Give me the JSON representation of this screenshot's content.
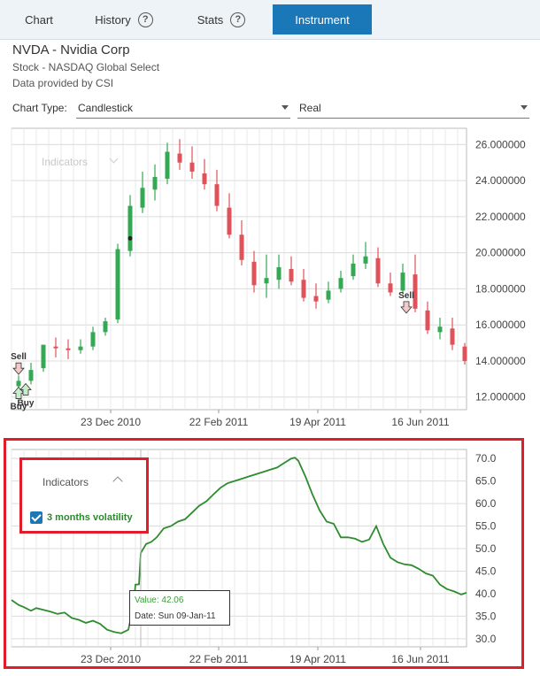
{
  "tabs": [
    {
      "label": "Chart",
      "help": false,
      "active": false
    },
    {
      "label": "History",
      "help": true,
      "active": false
    },
    {
      "label": "Stats",
      "help": true,
      "active": false
    },
    {
      "label": "Instrument",
      "help": false,
      "active": true
    }
  ],
  "instrument": {
    "title": "NVDA - Nvidia Corp",
    "exchange": "Stock - NASDAQ Global Select",
    "provider": "Data provided by CSI"
  },
  "controls": {
    "chart_type_label": "Chart Type:",
    "chart_type_value": "Candlestick",
    "price_mode_value": "Real"
  },
  "price_panel": {
    "indicators_label": "Indicators",
    "markers": [
      {
        "label": "Sell",
        "kind": "sell",
        "date": "2010-11-01",
        "price": 13.4
      },
      {
        "label": "Buy",
        "kind": "buy",
        "date": "2010-11-01",
        "price": 12.5
      },
      {
        "label": "Buy",
        "kind": "buy",
        "date": "2010-11-05",
        "price": 12.7
      },
      {
        "label": "Sell",
        "kind": "sell",
        "date": "2011-06-08",
        "price": 16.8
      }
    ]
  },
  "volatility_panel": {
    "indicators_label": "Indicators",
    "series_label": "3 months volatility",
    "series_checked": true,
    "tooltip_value": "Value: 42.06",
    "tooltip_date": "Date: Sun 09-Jan-11"
  },
  "chart_data": [
    {
      "type": "candlestick",
      "title": "",
      "x_tick_labels": [
        "23 Dec 2010",
        "22 Feb 2011",
        "19 Apr 2011",
        "16 Jun 2011"
      ],
      "y_tick_labels": [
        "12.000000",
        "14.000000",
        "16.000000",
        "18.000000",
        "20.000000",
        "22.000000",
        "24.000000",
        "26.000000"
      ],
      "ylim": [
        11.3,
        26.9
      ],
      "xlim": [
        "2010-10-28",
        "2011-07-12"
      ],
      "grid": true,
      "series": [
        {
          "x": [
            "2010-11-01",
            "2010-11-08",
            "2010-11-15",
            "2010-11-22",
            "2010-11-29",
            "2010-12-06",
            "2010-12-13",
            "2010-12-20",
            "2010-12-27",
            "2011-01-03",
            "2011-01-10",
            "2011-01-17",
            "2011-01-24",
            "2011-01-31",
            "2011-02-07",
            "2011-02-14",
            "2011-02-21",
            "2011-02-28",
            "2011-03-07",
            "2011-03-14",
            "2011-03-21",
            "2011-03-28",
            "2011-04-04",
            "2011-04-11",
            "2011-04-18",
            "2011-04-25",
            "2011-05-02",
            "2011-05-09",
            "2011-05-16",
            "2011-05-23",
            "2011-05-30",
            "2011-06-06",
            "2011-06-13",
            "2011-06-20",
            "2011-06-27",
            "2011-07-04",
            "2011-07-11"
          ],
          "open": [
            12.6,
            12.9,
            13.6,
            14.8,
            14.7,
            14.6,
            14.8,
            15.6,
            16.3,
            20.1,
            22.5,
            23.5,
            24.1,
            25.5,
            25.0,
            24.4,
            23.8,
            22.5,
            21.0,
            19.5,
            18.3,
            18.5,
            19.1,
            18.5,
            17.6,
            17.4,
            18.0,
            18.7,
            19.4,
            19.7,
            18.3,
            17.9,
            18.8,
            16.8,
            15.6,
            15.8,
            14.8
          ],
          "high": [
            13.2,
            13.9,
            14.9,
            15.3,
            15.2,
            15.2,
            15.9,
            16.4,
            20.5,
            23.2,
            24.5,
            24.9,
            26.1,
            26.3,
            25.9,
            25.2,
            24.6,
            23.3,
            21.8,
            20.1,
            19.9,
            19.9,
            19.8,
            19.1,
            18.3,
            18.4,
            19.0,
            19.9,
            20.6,
            20.3,
            18.9,
            19.4,
            19.9,
            17.3,
            16.4,
            16.4,
            15.0
          ],
          "low": [
            12.4,
            12.7,
            13.4,
            14.2,
            14.1,
            14.4,
            14.6,
            15.4,
            16.1,
            19.8,
            22.2,
            22.9,
            23.8,
            24.6,
            24.1,
            23.5,
            22.3,
            20.8,
            19.3,
            17.8,
            17.5,
            18.0,
            18.2,
            17.3,
            16.9,
            17.2,
            17.8,
            18.5,
            19.1,
            18.1,
            17.6,
            17.7,
            16.7,
            15.5,
            15.2,
            14.6,
            13.8
          ],
          "close": [
            12.9,
            13.5,
            14.9,
            14.7,
            14.6,
            14.8,
            15.6,
            16.2,
            20.2,
            22.6,
            23.6,
            24.2,
            25.6,
            25.0,
            24.5,
            23.8,
            22.6,
            21.0,
            19.6,
            18.2,
            18.6,
            19.2,
            18.4,
            17.5,
            17.3,
            17.9,
            18.6,
            19.4,
            19.8,
            18.3,
            17.8,
            18.9,
            16.9,
            15.7,
            15.9,
            14.9,
            14.0
          ]
        }
      ]
    },
    {
      "type": "line",
      "title": "",
      "x_tick_labels": [
        "23 Dec 2010",
        "22 Feb 2011",
        "19 Apr 2011",
        "16 Jun 2011"
      ],
      "y_tick_labels": [
        "30.0",
        "35.0",
        "40.0",
        "45.0",
        "50.0",
        "55.0",
        "60.0",
        "65.0",
        "70.0"
      ],
      "ylim": [
        28.2,
        72.0
      ],
      "xlim": [
        "2010-10-28",
        "2011-07-12"
      ],
      "grid": true,
      "series": [
        {
          "name": "3 months volatility",
          "x": [
            "2010-10-28",
            "2010-11-01",
            "2010-11-04",
            "2010-11-08",
            "2010-11-11",
            "2010-11-15",
            "2010-11-19",
            "2010-11-23",
            "2010-11-27",
            "2010-12-01",
            "2010-12-05",
            "2010-12-09",
            "2010-12-13",
            "2010-12-17",
            "2010-12-21",
            "2010-12-25",
            "2010-12-29",
            "2011-01-02",
            "2011-01-05",
            "2011-01-06",
            "2011-01-08",
            "2011-01-09",
            "2011-01-12",
            "2011-01-15",
            "2011-01-18",
            "2011-01-22",
            "2011-01-26",
            "2011-01-30",
            "2011-02-03",
            "2011-02-07",
            "2011-02-11",
            "2011-02-15",
            "2011-02-19",
            "2011-02-23",
            "2011-02-27",
            "2011-03-03",
            "2011-03-07",
            "2011-03-11",
            "2011-03-15",
            "2011-03-19",
            "2011-03-23",
            "2011-03-27",
            "2011-03-31",
            "2011-04-04",
            "2011-04-06",
            "2011-04-08",
            "2011-04-12",
            "2011-04-16",
            "2011-04-20",
            "2011-04-24",
            "2011-04-28",
            "2011-05-02",
            "2011-05-06",
            "2011-05-10",
            "2011-05-14",
            "2011-05-18",
            "2011-05-22",
            "2011-05-26",
            "2011-05-30",
            "2011-06-03",
            "2011-06-07",
            "2011-06-11",
            "2011-06-15",
            "2011-06-19",
            "2011-06-23",
            "2011-06-27",
            "2011-07-01",
            "2011-07-05",
            "2011-07-09",
            "2011-07-12"
          ],
          "y": [
            38.6,
            37.5,
            37.0,
            36.2,
            36.8,
            36.4,
            36.0,
            35.5,
            35.8,
            34.6,
            34.2,
            33.5,
            34.0,
            33.3,
            32.0,
            31.5,
            31.2,
            32.0,
            37.5,
            42.0,
            42.06,
            49.0,
            51.0,
            51.5,
            52.5,
            54.5,
            55.0,
            56.0,
            56.5,
            58.0,
            59.5,
            60.5,
            62.0,
            63.5,
            64.5,
            65.0,
            65.5,
            66.0,
            66.5,
            67.0,
            67.5,
            68.0,
            69.0,
            70.0,
            70.2,
            69.5,
            66.0,
            62.0,
            58.5,
            56.0,
            55.5,
            52.5,
            52.5,
            52.2,
            51.5,
            52.0,
            55.0,
            51.0,
            48.0,
            47.0,
            46.5,
            46.3,
            45.5,
            44.5,
            44.0,
            42.0,
            41.0,
            40.5,
            39.8,
            40.2
          ]
        }
      ]
    }
  ]
}
